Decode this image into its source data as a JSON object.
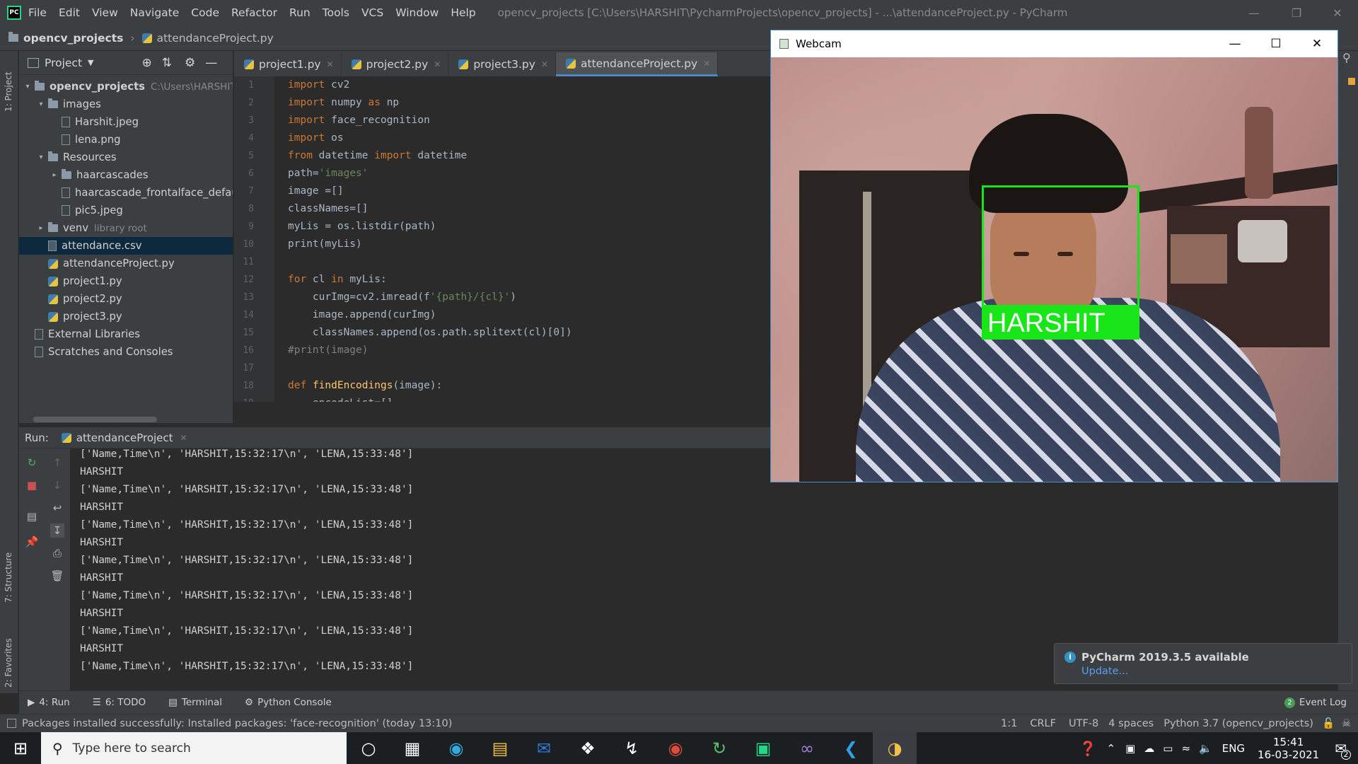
{
  "title_bar": {
    "menu": [
      "File",
      "Edit",
      "View",
      "Navigate",
      "Code",
      "Refactor",
      "Run",
      "Tools",
      "VCS",
      "Window",
      "Help"
    ],
    "window_title": "opencv_projects [C:\\Users\\HARSHIT\\PycharmProjects\\opencv_projects] - ...\\attendanceProject.py - PyCharm"
  },
  "breadcrumb": {
    "project": "opencv_projects",
    "file": "attendanceProject.py"
  },
  "project_panel": {
    "header": "Project",
    "tree": [
      {
        "label": "opencv_projects",
        "hint": "C:\\Users\\HARSHIT\\Pychar",
        "kind": "folder",
        "depth": 0,
        "open": true
      },
      {
        "label": "images",
        "kind": "folder",
        "depth": 1,
        "open": true
      },
      {
        "label": "Harshit.jpeg",
        "kind": "file",
        "depth": 2
      },
      {
        "label": "lena.png",
        "kind": "file",
        "depth": 2
      },
      {
        "label": "Resources",
        "kind": "folder",
        "depth": 1,
        "open": true
      },
      {
        "label": "haarcascades",
        "kind": "folder",
        "depth": 2,
        "open": false
      },
      {
        "label": "haarcascade_frontalface_default.xml",
        "kind": "file",
        "depth": 2
      },
      {
        "label": "pic5.jpeg",
        "kind": "file",
        "depth": 2
      },
      {
        "label": "venv",
        "hint": "library root",
        "kind": "folder",
        "depth": 1,
        "open": false
      },
      {
        "label": "attendance.csv",
        "kind": "csv",
        "depth": 1,
        "selected": true
      },
      {
        "label": "attendanceProject.py",
        "kind": "py",
        "depth": 1
      },
      {
        "label": "project1.py",
        "kind": "py",
        "depth": 1
      },
      {
        "label": "project2.py",
        "kind": "py",
        "depth": 1
      },
      {
        "label": "project3.py",
        "kind": "py",
        "depth": 1
      },
      {
        "label": "External Libraries",
        "kind": "lib",
        "depth": 0
      },
      {
        "label": "Scratches and Consoles",
        "kind": "scratch",
        "depth": 0
      }
    ]
  },
  "side_tabs": {
    "project": "1: Project",
    "structure": "7: Structure",
    "favorites": "2: Favorites"
  },
  "editor_tabs": [
    {
      "label": "project1.py",
      "active": false
    },
    {
      "label": "project2.py",
      "active": false
    },
    {
      "label": "project3.py",
      "active": false
    },
    {
      "label": "attendanceProject.py",
      "active": true
    }
  ],
  "code_lines": [
    {
      "n": "1",
      "t": "import cv2"
    },
    {
      "n": "2",
      "t": "import numpy as np"
    },
    {
      "n": "3",
      "t": "import face_recognition"
    },
    {
      "n": "4",
      "t": "import os"
    },
    {
      "n": "5",
      "t": "from datetime import datetime"
    },
    {
      "n": "6",
      "t": "path='images'"
    },
    {
      "n": "7",
      "t": "image =[]"
    },
    {
      "n": "8",
      "t": "classNames=[]"
    },
    {
      "n": "9",
      "t": "myLis = os.listdir(path)"
    },
    {
      "n": "10",
      "t": "print(myLis)"
    },
    {
      "n": "11",
      "t": ""
    },
    {
      "n": "12",
      "t": "for cl in myLis:"
    },
    {
      "n": "13",
      "t": "    curImg=cv2.imread(f'{path}/{cl}')"
    },
    {
      "n": "14",
      "t": "    image.append(curImg)"
    },
    {
      "n": "15",
      "t": "    classNames.append(os.path.splitext(cl)[0])"
    },
    {
      "n": "16",
      "t": "#print(image)"
    },
    {
      "n": "17",
      "t": ""
    },
    {
      "n": "18",
      "t": "def findEncodings(image):"
    },
    {
      "n": "19",
      "t": "    encodeList=[]"
    }
  ],
  "run_panel": {
    "label": "Run:",
    "config": "attendanceProject",
    "output": [
      "['Name,Time\\n', 'HARSHIT,15:32:17\\n', 'LENA,15:33:48']",
      "HARSHIT",
      "['Name,Time\\n', 'HARSHIT,15:32:17\\n', 'LENA,15:33:48']",
      "HARSHIT",
      "['Name,Time\\n', 'HARSHIT,15:32:17\\n', 'LENA,15:33:48']",
      "HARSHIT",
      "['Name,Time\\n', 'HARSHIT,15:32:17\\n', 'LENA,15:33:48']",
      "HARSHIT",
      "['Name,Time\\n', 'HARSHIT,15:32:17\\n', 'LENA,15:33:48']",
      "HARSHIT",
      "['Name,Time\\n', 'HARSHIT,15:32:17\\n', 'LENA,15:33:48']",
      "HARSHIT",
      "['Name,Time\\n', 'HARSHIT,15:32:17\\n', 'LENA,15:33:48']"
    ]
  },
  "webcam_window": {
    "title": "Webcam",
    "face_label": "HARSHIT",
    "box_color": "#19e619"
  },
  "notification": {
    "title": "PyCharm 2019.3.5 available",
    "link": "Update..."
  },
  "bottom_tabs": [
    "4: Run",
    "6: TODO",
    "Terminal",
    "Python Console"
  ],
  "event_log": {
    "count": "2",
    "label": "Event Log"
  },
  "status_bar": {
    "message": "Packages installed successfully: Installed packages: 'face-recognition' (today 13:10)",
    "position": "1:1",
    "line_sep": "CRLF",
    "encoding": "UTF-8",
    "indent": "4 spaces",
    "interpreter": "Python 3.7 (opencv_projects)"
  },
  "taskbar": {
    "search_placeholder": "Type here to search",
    "language": "ENG",
    "time": "15:41",
    "date": "16-03-2021",
    "notifications": "2"
  },
  "colors": {
    "accent": "#4a88c7",
    "selection": "#0d293e",
    "keyword": "#cc7832",
    "string": "#6a8759",
    "function": "#ffc66d"
  }
}
